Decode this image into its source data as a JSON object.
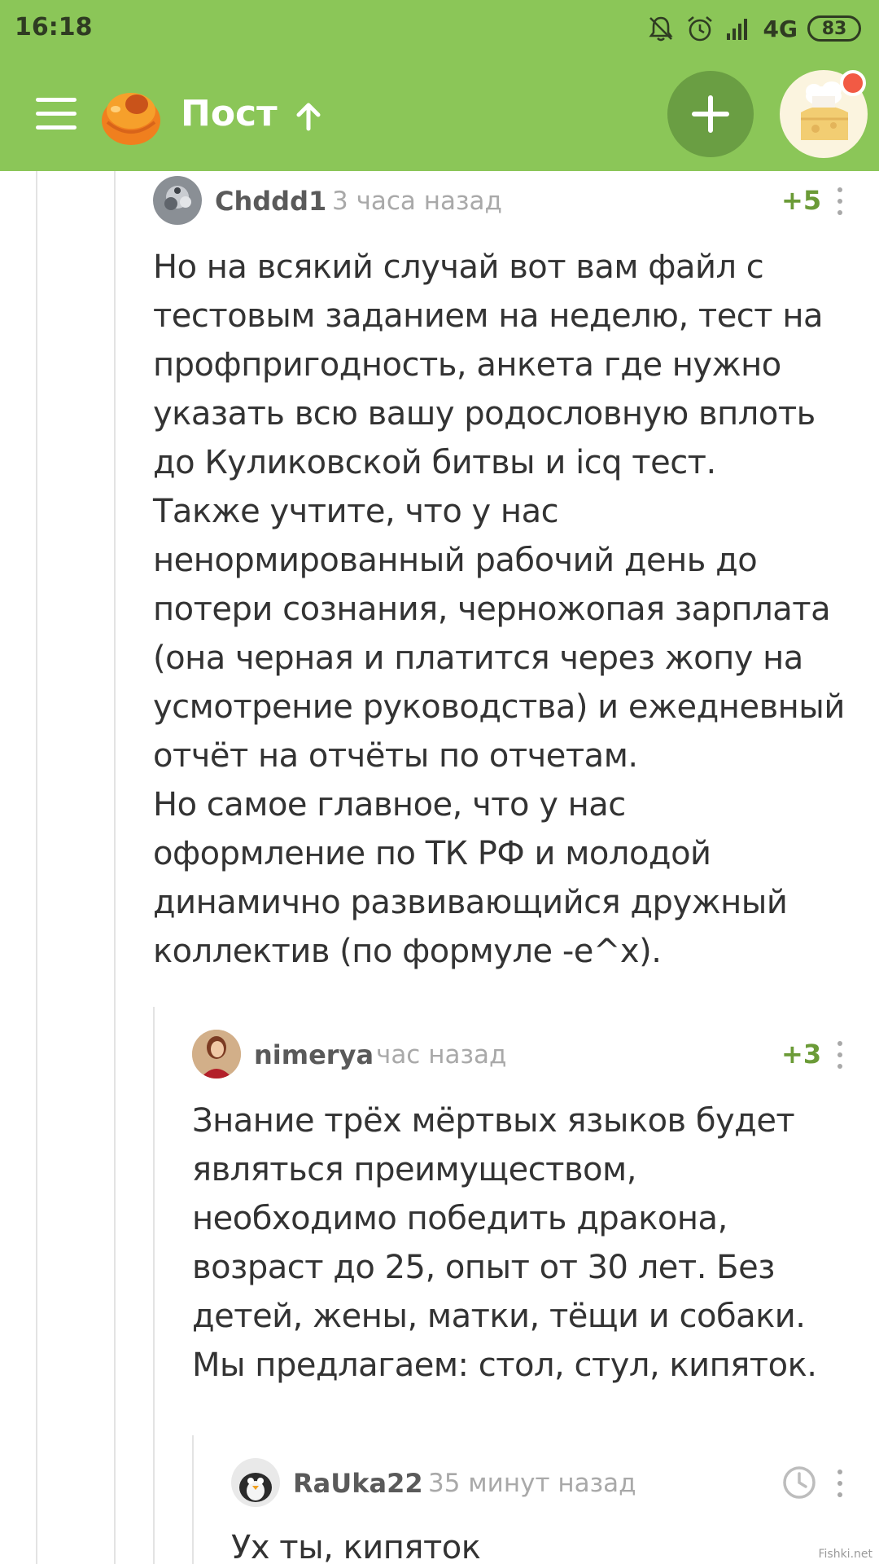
{
  "status_bar": {
    "time": "16:18",
    "network": "4G",
    "battery": "83"
  },
  "app_bar": {
    "title": "Пост"
  },
  "comments": [
    {
      "author": "Chddd1",
      "time": "3 часа назад",
      "rating": "+5",
      "text": "Но на всякий случай вот вам файл с\nтестовым заданием на неделю, тест на\nпрофпригодность, анкета где нужно\nуказать всю вашу родословную вплоть\nдо Куликовской битвы и icq тест.\nТакже учтите, что у нас\nненормированный рабочий день до\nпотери сознания, черножопая зарплата\n(она черная и платится через жопу на\nусмотрение руководства) и ежедневный\nотчёт на отчёты по отчетам.\nНо самое главное, что у нас\nоформление по ТК РФ и молодой\nдинамично развивающийся дружный\nколлектив (по формуле -e^x)."
    },
    {
      "author": "nimerya",
      "time": "час назад",
      "rating": "+3",
      "text": "Знание трёх мёртвых языков будет\nявляться преимуществом,\nнеобходимо победить дракона,\nвозраст до 25, опыт от 30 лет. Без\nдетей, жены, матки, тёщи и собаки.\nМы предлагаем: стол, стул, кипяток."
    },
    {
      "author": "RaUka22",
      "time": "35 минут назад",
      "rating": "",
      "text": "Ух ты, кипяток"
    }
  ],
  "watermark": "Fishki.net",
  "colors": {
    "header_bg": "#8bc658",
    "add_button_bg": "#6a9e43",
    "rating_green": "#6b9b37",
    "notification_dot": "#f25a44"
  }
}
